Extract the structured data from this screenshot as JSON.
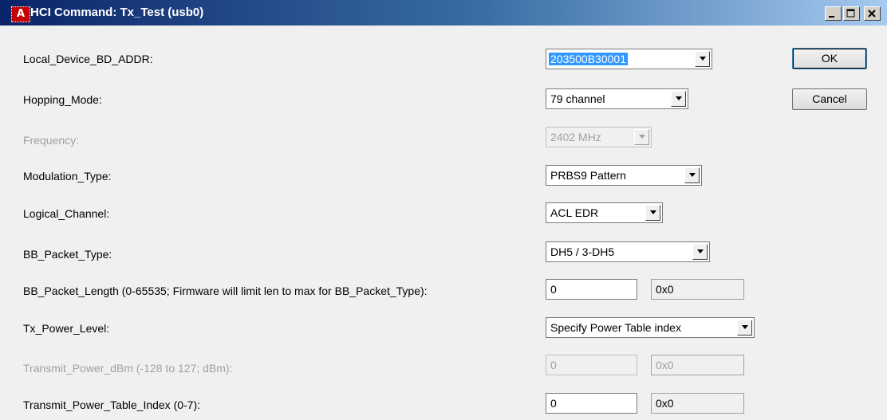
{
  "window": {
    "title": "HCI Command: Tx_Test (usb0)",
    "app_icon_glyph": "A",
    "controls": [
      "minimize-icon",
      "maximize-icon",
      "close-icon"
    ]
  },
  "fields": {
    "local_addr": {
      "label": "Local_Device_BD_ADDR:",
      "value": "203500B30001"
    },
    "hopping": {
      "label": "Hopping_Mode:",
      "value": "79 channel"
    },
    "frequency": {
      "label": "Frequency:",
      "value": "2402 MHz"
    },
    "modulation": {
      "label": "Modulation_Type:",
      "value": "PRBS9 Pattern"
    },
    "logical_channel": {
      "label": "Logical_Channel:",
      "value": "ACL EDR"
    },
    "packet_type": {
      "label": "BB_Packet_Type:",
      "value": "DH5 / 3-DH5"
    },
    "packet_length": {
      "label": "BB_Packet_Length (0-65535; Firmware will limit len to max for BB_Packet_Type):",
      "value": "0",
      "hex": "0x0"
    },
    "power_level": {
      "label": "Tx_Power_Level:",
      "value": "Specify Power Table index"
    },
    "power_dbm": {
      "label": "Transmit_Power_dBm (-128 to 127; dBm):",
      "value": "0",
      "hex": "0x0"
    },
    "power_index": {
      "label": "Transmit_Power_Table_Index (0-7):",
      "value": "0",
      "hex": "0x0"
    }
  },
  "buttons": {
    "ok": "OK",
    "cancel": "Cancel"
  },
  "colors": {
    "titlebar_start": "#0a246a",
    "titlebar_end": "#a6caf0",
    "selection": "#3399ff",
    "disabled_text": "#a0a0a0"
  }
}
